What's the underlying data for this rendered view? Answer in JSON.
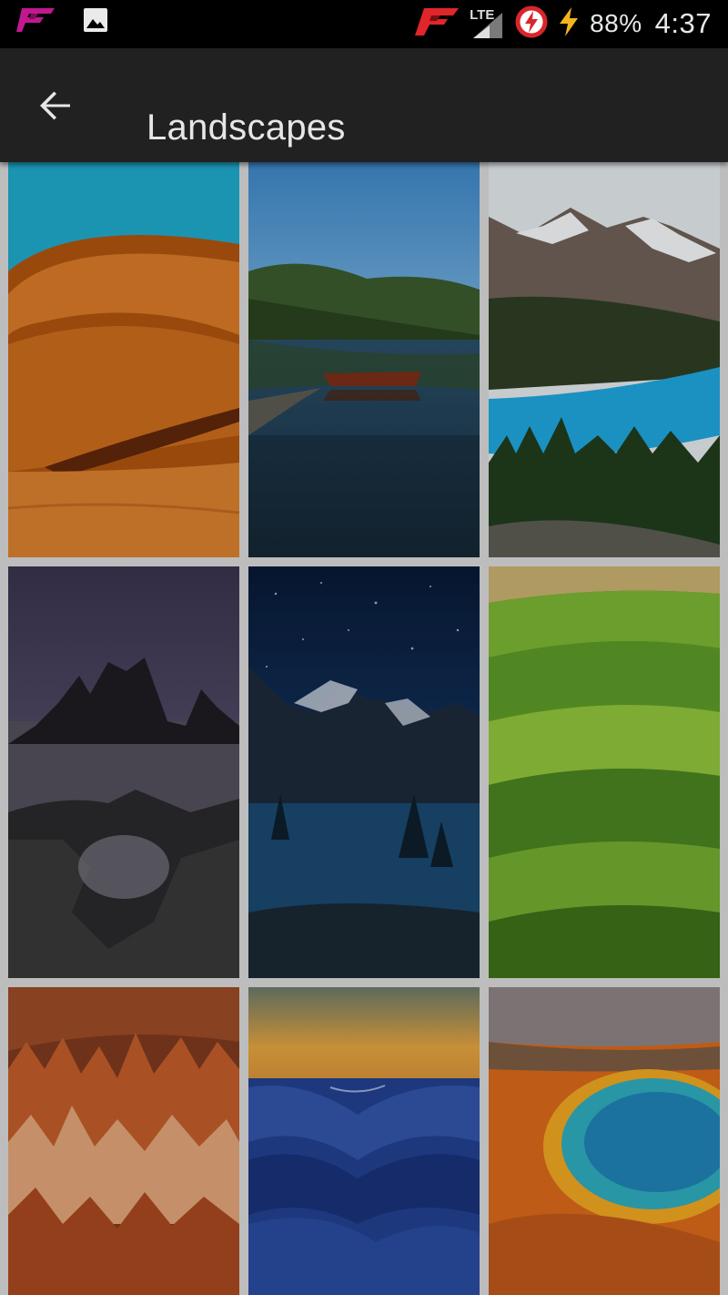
{
  "status_bar": {
    "lte_label": "LTE",
    "battery": "88%",
    "time": "4:37",
    "icons": [
      "app-logo-icon",
      "image-notification-icon",
      "app-logo-icon",
      "signal-icon",
      "data-saver-icon",
      "charging-icon"
    ]
  },
  "app_bar": {
    "back_icon": "arrow-back-icon",
    "title": "Landscapes"
  },
  "wallpapers": [
    {
      "subject": "desert dunes",
      "colors": {
        "sky": "#1fa3c4",
        "sand": "#c8641c"
      }
    },
    {
      "subject": "lake with boat",
      "colors": {
        "sky": "#3f8cc8",
        "water": "#173a55"
      }
    },
    {
      "subject": "turquoise mountain lake",
      "colors": {
        "sky": "#e8eef0",
        "lake": "#20a0d6"
      }
    },
    {
      "subject": "sea stacks at dusk",
      "colors": {
        "sky": "#5b5478",
        "rock": "#2e2e30"
      }
    },
    {
      "subject": "starry mountain lake",
      "colors": {
        "sky": "#0f2950",
        "lake": "#1a4a78"
      }
    },
    {
      "subject": "green rolling fields",
      "colors": {
        "field": "#6ba82c",
        "light": "#9ccd44"
      }
    },
    {
      "subject": "red rock canyon hoodoos",
      "colors": {
        "rock": "#b85628",
        "light": "#e6b08a"
      }
    },
    {
      "subject": "blue waves at sunset",
      "colors": {
        "sky": "#e8a642",
        "wave": "#1e3a92"
      }
    },
    {
      "subject": "hot spring",
      "colors": {
        "pool": "#2fb4d0",
        "rim": "#e36a14"
      }
    }
  ]
}
